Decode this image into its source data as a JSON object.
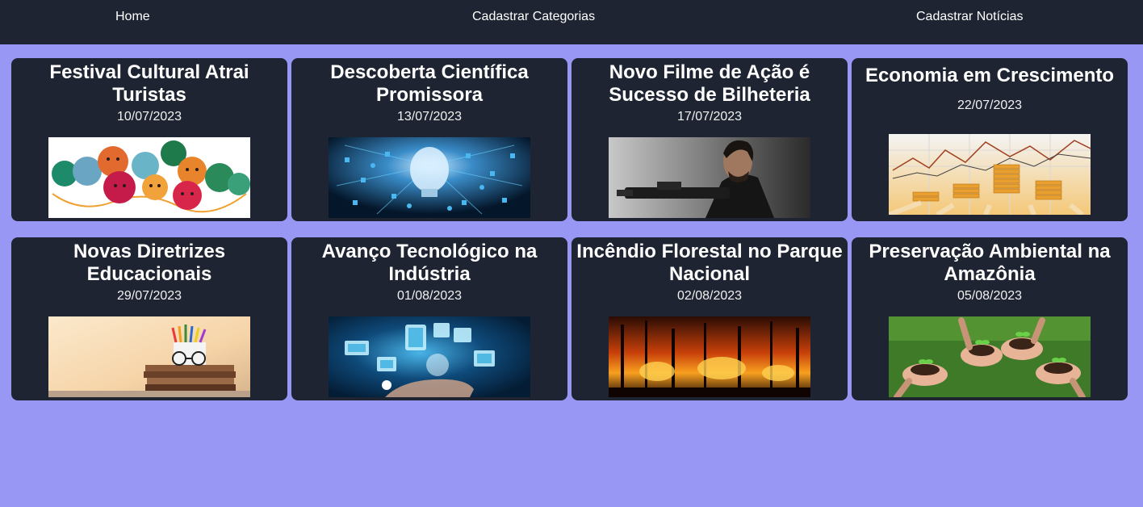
{
  "nav": {
    "home": "Home",
    "categories": "Cadastrar Categorias",
    "news": "Cadastrar Notícias"
  },
  "cards": [
    {
      "title": "Festival Cultural Atrai Turistas",
      "date": "10/07/2023",
      "image": "colorful-faces-illustration"
    },
    {
      "title": "Descoberta Científica Promissora",
      "date": "13/07/2023",
      "image": "lightbulb-icons"
    },
    {
      "title": "Novo Filme de Ação é Sucesso de Bilheteria",
      "date": "17/07/2023",
      "image": "man-with-gun"
    },
    {
      "title": "Economia em Crescimento",
      "date": "22/07/2023",
      "image": "coins-and-chart"
    },
    {
      "title": "Novas Diretrizes Educacionais",
      "date": "29/07/2023",
      "image": "books-and-pencils"
    },
    {
      "title": "Avanço Tecnológico na Indústria",
      "date": "01/08/2023",
      "image": "hand-with-tech-icons"
    },
    {
      "title": "Incêndio Florestal no Parque Nacional",
      "date": "02/08/2023",
      "image": "forest-fire"
    },
    {
      "title": "Preservação Ambiental na Amazônia",
      "date": "05/08/2023",
      "image": "hands-holding-seedlings"
    }
  ],
  "colors": {
    "background": "#9898f4",
    "navbar": "#1e2431",
    "card": "#1e2431",
    "text": "#ffffff"
  }
}
